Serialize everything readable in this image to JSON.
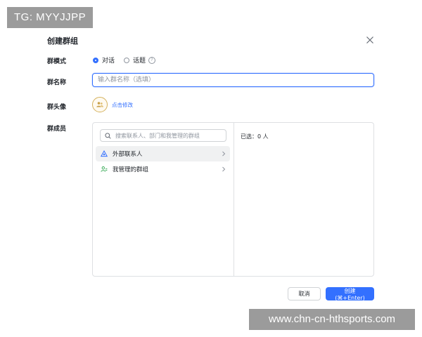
{
  "watermarks": {
    "top_left": "TG: MYYJJPP",
    "bottom_right": "www.chn-cn-hthsports.com"
  },
  "dialog": {
    "title": "创建群组",
    "close_icon": "close-icon",
    "mode": {
      "label": "群模式",
      "options": [
        {
          "label": "对话",
          "selected": true
        },
        {
          "label": "话题",
          "selected": false
        }
      ],
      "help_icon": "question-circle-icon"
    },
    "name": {
      "label": "群名称",
      "placeholder": "输入群名称（选填）",
      "value": ""
    },
    "avatar": {
      "label": "群头像",
      "icon": "group-avatar-icon",
      "edit_label": "点击修改"
    },
    "members": {
      "label": "群成员",
      "search_placeholder": "搜索联系人、部门和我管理的群组",
      "items": [
        {
          "label": "外部联系人",
          "icon": "external-contacts-icon"
        },
        {
          "label": "我管理的群组",
          "icon": "managed-groups-icon"
        }
      ],
      "selected_text": "已选：0 人"
    },
    "buttons": {
      "cancel": "取消",
      "create": "创建(⌘+Enter)"
    }
  },
  "colors": {
    "accent": "#3370ff",
    "avatar_border": "#d4b15c",
    "external_icon": "#3370ff",
    "groups_icon": "#34a853"
  }
}
